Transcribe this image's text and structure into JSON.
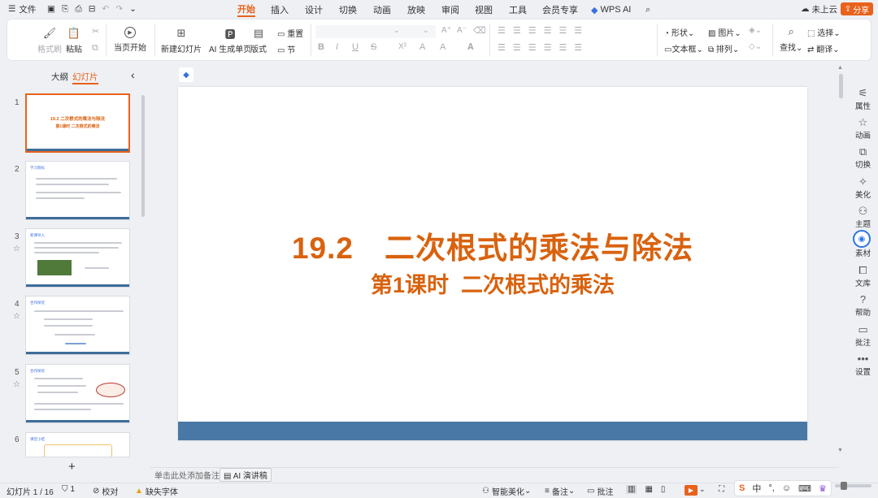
{
  "menu": {
    "hamburger": "☰",
    "file": "文件"
  },
  "tabs": [
    "开始",
    "插入",
    "设计",
    "切换",
    "动画",
    "放映",
    "审阅",
    "视图",
    "工具",
    "会员专享",
    "WPS AI"
  ],
  "topright": {
    "cloud": "未上云",
    "share": "分享"
  },
  "ribbon": {
    "format_painter": "格式刷",
    "paste": "粘贴",
    "from_start": "当页开始",
    "new_slide": "新建幻灯片",
    "ai_single": "AI 生成单页",
    "layout": "版式",
    "reset": "重置",
    "section": "节",
    "font_name": "",
    "font_size": "",
    "bold": "B",
    "italic": "I",
    "underline": "U",
    "strike": "S",
    "superscript": "X²",
    "shape": "形状",
    "picture": "图片",
    "textbox": "文本框",
    "arrange": "排列",
    "find": "查找",
    "select": "选择",
    "translate": "翻译"
  },
  "sidebar": {
    "outline": "大纲",
    "slides": "幻灯片",
    "add": "+",
    "collapse": "‹",
    "nums": [
      "1",
      "2",
      "3",
      "4",
      "5",
      "6"
    ],
    "thumb1_title": "19.2 二次根式的乘法与除法",
    "thumb1_sub": "第1课时 二次根式的乘法",
    "thumb_labels": [
      "学习目标",
      "新课导入",
      "合作探究",
      "合作探究",
      "课堂小结"
    ]
  },
  "slide": {
    "title": "19.2　二次根式的乘法与除法",
    "subtitle": "第1课时  二次根式的乘法"
  },
  "right_panel": [
    "属性",
    "动画",
    "切换",
    "美化",
    "主题",
    "素材",
    "文库",
    "帮助",
    "批注",
    "设置"
  ],
  "notes": {
    "placeholder": "单击此处添加备注",
    "ai_speech": "AI 演讲稿"
  },
  "status": {
    "slide_info": "幻灯片 1 / 16",
    "count": "1",
    "proof": "校对",
    "missing_font": "缺失字体",
    "smart": "智能美化",
    "notes": "备注",
    "comment": "批注",
    "ime": "中"
  },
  "colors": {
    "accent": "#e8621c",
    "title": "#d9620e",
    "slide_bar": "#4a78a6"
  }
}
